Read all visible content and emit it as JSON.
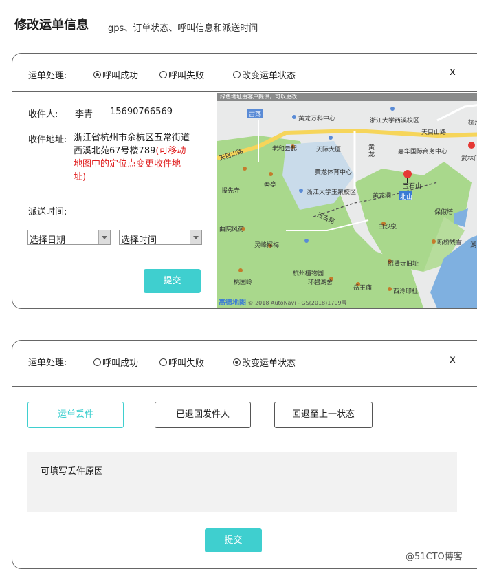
{
  "header": {
    "title": "修改运单信息",
    "subtitle": "gps、订单状态、呼叫信息和派送时间"
  },
  "card1": {
    "label": "运单处理:",
    "options": [
      "呼叫成功",
      "呼叫失败",
      "改变运单状态"
    ],
    "selected": 0,
    "close": "x",
    "recipient_label": "收件人:",
    "recipient_name": "李青",
    "recipient_phone": "15690766569",
    "address_label": "收件地址:",
    "address_text": "浙江省杭州市余杭区五常街道西溪北苑67号楼789",
    "address_hint": "(可移动地图中的定位点变更收件地址)",
    "delivery_label": "派送时间:",
    "date_select": "选择日期",
    "time_select": "选择时间",
    "submit": "提交",
    "map": {
      "banner": "绿色地址由客户提供，可以更改!",
      "labels": [
        "古荡",
        "黄龙万科中心",
        "浙江大学西溪校区",
        "杭州火",
        "天目山路",
        "天目山路",
        "老和云起",
        "天际大厦",
        "黄龙",
        "嘉华国际商务中心",
        "武林门",
        "黄龙体育中心",
        "宝石山",
        "报先寺",
        "秦亭",
        "浙江大学玉泉校区",
        "黄龙洞",
        "北山",
        "保俶塔",
        "玉古路",
        "白沙泉",
        "曲院风荷",
        "灵峰探梅",
        "杭州植物园",
        "断桥残雪",
        "环碧湖舍",
        "岳王庙",
        "招贤寺旧址",
        "桃园岭",
        "西泠印社",
        "湖"
      ],
      "footer_logo": "高德地图",
      "footer_copy": "© 2018 AutoNavi - GS(2018)1709号"
    }
  },
  "card2": {
    "label": "运单处理:",
    "options": [
      "呼叫成功",
      "呼叫失败",
      "改变运单状态"
    ],
    "selected": 2,
    "close": "x",
    "status_buttons": [
      "运单丢件",
      "已退回发件人",
      "回退至上一状态"
    ],
    "reason_placeholder": "可填写丢件原因",
    "submit": "提交"
  },
  "watermark": "@51CTO博客",
  "colors": {
    "accent": "#3fcfcf",
    "hint_red": "#e02020",
    "map_green": "#a9d88c",
    "map_water": "#7fb0e0",
    "map_road": "#f6d55a"
  }
}
